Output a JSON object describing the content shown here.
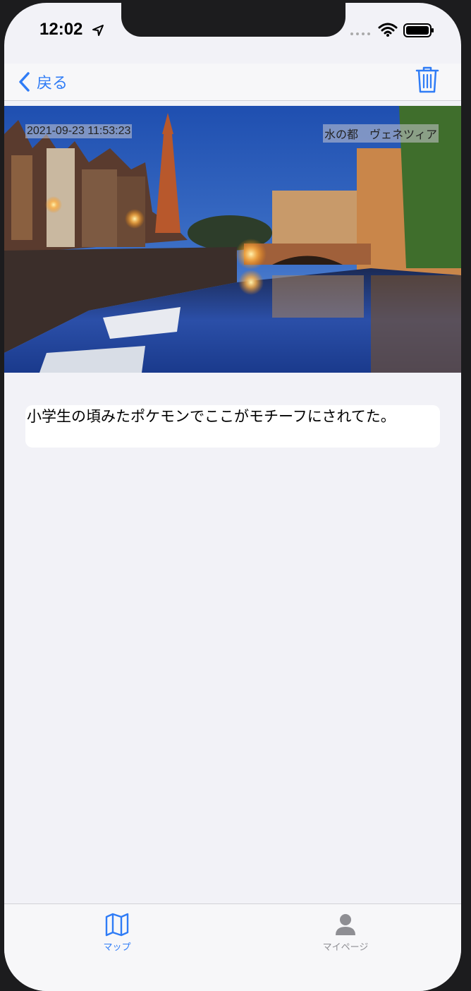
{
  "status_bar": {
    "time": "12:02",
    "icons": [
      "location-arrow-icon",
      "signal-dots-icon",
      "wifi-icon",
      "battery-icon"
    ]
  },
  "nav": {
    "back_label": "戻る",
    "trash_icon": "trash-icon"
  },
  "photo": {
    "date": "2021-09-23 11:53:23",
    "title": "水の都　ヴェネツィア"
  },
  "memo": {
    "text": "小学生の頃みたポケモンでここがモチーフにされてた。"
  },
  "tabbar": {
    "tabs": [
      {
        "label": "マップ",
        "icon": "map-icon",
        "active": true
      },
      {
        "label": "マイページ",
        "icon": "person-icon",
        "active": false
      }
    ]
  },
  "colors": {
    "accent": "#2f7cf6",
    "background": "#f2f2f7",
    "inactive": "#8e8e93"
  }
}
